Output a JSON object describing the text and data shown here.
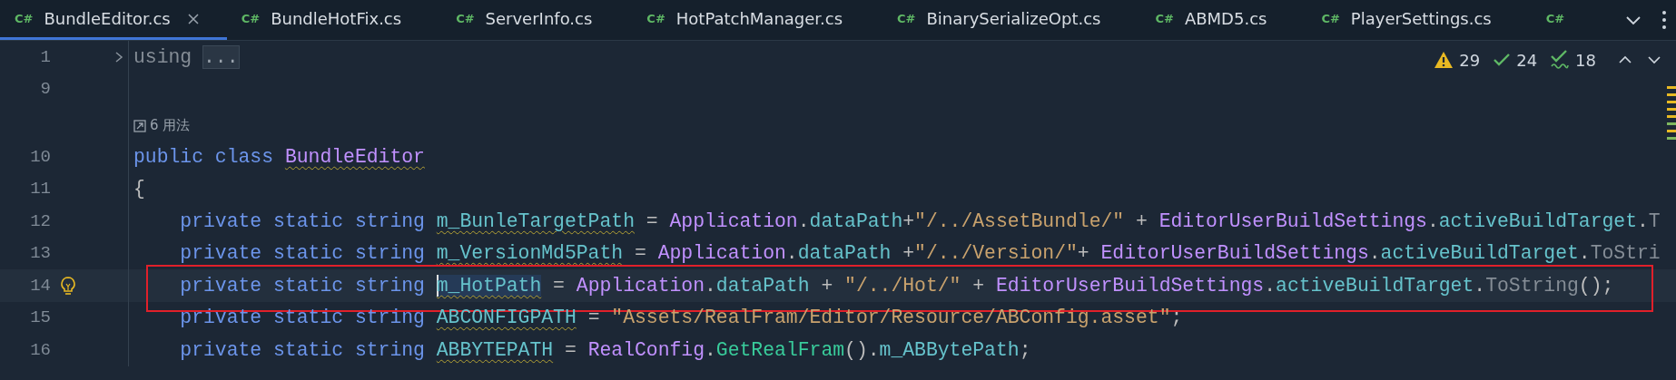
{
  "tabs": [
    {
      "badge": "C#",
      "label": "BundleEditor.cs",
      "selected": true,
      "closable": true
    },
    {
      "badge": "C#",
      "label": "BundleHotFix.cs",
      "selected": false,
      "closable": false
    },
    {
      "badge": "C#",
      "label": "ServerInfo.cs",
      "selected": false,
      "closable": false
    },
    {
      "badge": "C#",
      "label": "HotPatchManager.cs",
      "selected": false,
      "closable": false
    },
    {
      "badge": "C#",
      "label": "BinarySerializeOpt.cs",
      "selected": false,
      "closable": false
    },
    {
      "badge": "C#",
      "label": "ABMD5.cs",
      "selected": false,
      "closable": false
    },
    {
      "badge": "C#",
      "label": "PlayerSettings.cs",
      "selected": false,
      "closable": false
    },
    {
      "badge": "C#",
      "selected": false,
      "closable": false
    }
  ],
  "inspections": {
    "warnings": "29",
    "weak_warnings": "24",
    "typos": "18"
  },
  "lines": [
    {
      "kind": "code",
      "number": "1",
      "current": false,
      "folded": true,
      "tokens": [
        {
          "text": "using ",
          "kind": "dim",
          "warn": false,
          "selected": false
        },
        {
          "text": "...",
          "kind": "fold",
          "warn": false,
          "selected": false
        }
      ]
    },
    {
      "kind": "code",
      "number": "9",
      "current": false,
      "folded": false
    },
    {
      "kind": "hint",
      "text": "6 用法"
    },
    {
      "kind": "code",
      "number": "10",
      "current": false,
      "folded": false,
      "tokens": [
        {
          "text": "public class ",
          "kind": "kw",
          "warn": false,
          "selected": false
        },
        {
          "text": "BundleEditor",
          "kind": "cls",
          "warn": true,
          "selected": false
        }
      ]
    },
    {
      "kind": "code",
      "number": "11",
      "current": false,
      "folded": false,
      "tokens": [
        {
          "text": "{",
          "kind": "plain",
          "warn": false,
          "selected": false
        }
      ]
    },
    {
      "kind": "code",
      "number": "12",
      "current": false,
      "folded": false,
      "tokens": [
        {
          "text": "    private static string ",
          "kind": "kw",
          "warn": false,
          "selected": false
        },
        {
          "text": "m_BunleTargetPath",
          "kind": "field",
          "warn": true,
          "selected": false
        },
        {
          "text": " = ",
          "kind": "plain",
          "warn": false,
          "selected": false
        },
        {
          "text": "Application",
          "kind": "cls",
          "warn": false,
          "selected": false
        },
        {
          "text": ".",
          "kind": "plain",
          "warn": false,
          "selected": false
        },
        {
          "text": "dataPath",
          "kind": "field",
          "warn": false,
          "selected": false
        },
        {
          "text": "+",
          "kind": "plain",
          "warn": false,
          "selected": false
        },
        {
          "text": "\"/../AssetBundle/\"",
          "kind": "str",
          "warn": false,
          "selected": false
        },
        {
          "text": " + ",
          "kind": "plain",
          "warn": false,
          "selected": false
        },
        {
          "text": "EditorUserBuildSettings",
          "kind": "cls",
          "warn": false,
          "selected": false
        },
        {
          "text": ".",
          "kind": "plain",
          "warn": false,
          "selected": false
        },
        {
          "text": "activeBuildTarget",
          "kind": "field",
          "warn": false,
          "selected": false
        },
        {
          "text": ".",
          "kind": "plain",
          "warn": false,
          "selected": false
        },
        {
          "text": "T",
          "kind": "dim",
          "warn": false,
          "selected": false
        }
      ]
    },
    {
      "kind": "code",
      "number": "13",
      "current": false,
      "folded": false,
      "tokens": [
        {
          "text": "    private static string ",
          "kind": "kw",
          "warn": false,
          "selected": false
        },
        {
          "text": "m_VersionMd5Path",
          "kind": "field",
          "warn": true,
          "selected": false
        },
        {
          "text": " = ",
          "kind": "plain",
          "warn": false,
          "selected": false
        },
        {
          "text": "Application",
          "kind": "cls",
          "warn": false,
          "selected": false
        },
        {
          "text": ".",
          "kind": "plain",
          "warn": false,
          "selected": false
        },
        {
          "text": "dataPath",
          "kind": "field",
          "warn": false,
          "selected": false
        },
        {
          "text": " +",
          "kind": "plain",
          "warn": false,
          "selected": false
        },
        {
          "text": "\"/../Version/\"",
          "kind": "str",
          "warn": false,
          "selected": false
        },
        {
          "text": "+ ",
          "kind": "plain",
          "warn": false,
          "selected": false
        },
        {
          "text": "EditorUserBuildSettings",
          "kind": "cls",
          "warn": false,
          "selected": false
        },
        {
          "text": ".",
          "kind": "plain",
          "warn": false,
          "selected": false
        },
        {
          "text": "activeBuildTarget",
          "kind": "field",
          "warn": false,
          "selected": false
        },
        {
          "text": ".",
          "kind": "plain",
          "warn": false,
          "selected": false
        },
        {
          "text": "ToStri",
          "kind": "dim",
          "warn": false,
          "selected": false
        }
      ]
    },
    {
      "kind": "code",
      "number": "14",
      "current": true,
      "folded": false,
      "tokens": [
        {
          "text": "    private static string ",
          "kind": "kw",
          "warn": false,
          "selected": false
        },
        {
          "text": "m_HotPath",
          "kind": "field",
          "warn": true,
          "selected": true
        },
        {
          "text": " = ",
          "kind": "plain",
          "warn": false,
          "selected": false
        },
        {
          "text": "Application",
          "kind": "cls",
          "warn": false,
          "selected": false
        },
        {
          "text": ".",
          "kind": "plain",
          "warn": false,
          "selected": false
        },
        {
          "text": "dataPath",
          "kind": "field",
          "warn": false,
          "selected": false
        },
        {
          "text": " + ",
          "kind": "plain",
          "warn": false,
          "selected": false
        },
        {
          "text": "\"/../Hot/\"",
          "kind": "str",
          "warn": false,
          "selected": false
        },
        {
          "text": " + ",
          "kind": "plain",
          "warn": false,
          "selected": false
        },
        {
          "text": "EditorUserBuildSettings",
          "kind": "cls",
          "warn": false,
          "selected": false
        },
        {
          "text": ".",
          "kind": "plain",
          "warn": false,
          "selected": false
        },
        {
          "text": "activeBuildTarget",
          "kind": "field",
          "warn": false,
          "selected": false
        },
        {
          "text": ".",
          "kind": "plain",
          "warn": false,
          "selected": false
        },
        {
          "text": "ToString",
          "kind": "dim",
          "warn": false,
          "selected": false
        },
        {
          "text": "();",
          "kind": "plain",
          "warn": false,
          "selected": false
        }
      ]
    },
    {
      "kind": "code",
      "number": "15",
      "current": false,
      "folded": false,
      "tokens": [
        {
          "text": "    private static string ",
          "kind": "kw",
          "warn": false,
          "selected": false
        },
        {
          "text": "ABCONFIGPATH",
          "kind": "field",
          "warn": true,
          "selected": false
        },
        {
          "text": " = ",
          "kind": "plain",
          "warn": false,
          "selected": false
        },
        {
          "text": "\"Assets/RealFram/Editor/Resource/ABConfig.asset\"",
          "kind": "str",
          "warn": false,
          "selected": false
        },
        {
          "text": ";",
          "kind": "plain",
          "warn": false,
          "selected": false
        }
      ]
    },
    {
      "kind": "code",
      "number": "16",
      "current": false,
      "folded": false,
      "tokens": [
        {
          "text": "    private static string ",
          "kind": "kw",
          "warn": false,
          "selected": false
        },
        {
          "text": "ABBYTEPATH",
          "kind": "field",
          "warn": true,
          "selected": false
        },
        {
          "text": " = ",
          "kind": "plain",
          "warn": false,
          "selected": false
        },
        {
          "text": "RealConfig",
          "kind": "cls",
          "warn": false,
          "selected": false
        },
        {
          "text": ".",
          "kind": "plain",
          "warn": false,
          "selected": false
        },
        {
          "text": "GetRealFram",
          "kind": "method",
          "warn": false,
          "selected": false
        },
        {
          "text": "().",
          "kind": "plain",
          "warn": false,
          "selected": false
        },
        {
          "text": "m_ABBytePath",
          "kind": "field",
          "warn": false,
          "selected": false
        },
        {
          "text": ";",
          "kind": "plain",
          "warn": false,
          "selected": false
        }
      ]
    }
  ]
}
